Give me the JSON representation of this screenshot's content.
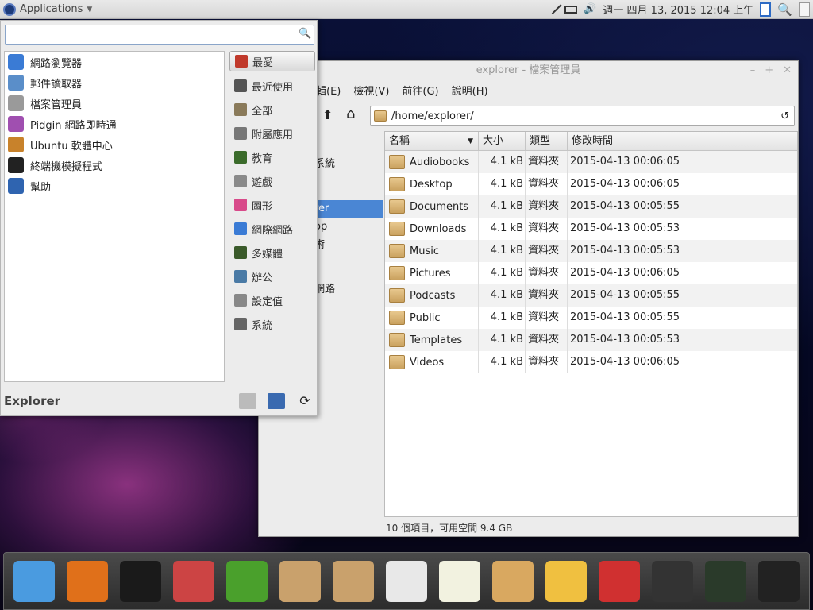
{
  "panel": {
    "applications_label": "Applications",
    "clock": "週一 四月 13, 2015 12:04 上午"
  },
  "menu": {
    "search_placeholder": "",
    "favorites": [
      {
        "label": "網路瀏覽器",
        "icon": "web-browser-icon",
        "color": "#3a7bd5"
      },
      {
        "label": "郵件讀取器",
        "icon": "mail-reader-icon",
        "color": "#5a8ec9"
      },
      {
        "label": "檔案管理員",
        "icon": "file-manager-icon",
        "color": "#9a9a9a"
      },
      {
        "label": "Pidgin 網路即時通",
        "icon": "pidgin-icon",
        "color": "#a04fb0"
      },
      {
        "label": "Ubuntu 軟體中心",
        "icon": "software-center-icon",
        "color": "#c8822b"
      },
      {
        "label": "終端機模擬程式",
        "icon": "terminal-icon",
        "color": "#222222"
      },
      {
        "label": "幫助",
        "icon": "help-icon",
        "color": "#2f64b0"
      }
    ],
    "categories": [
      {
        "label": "最愛",
        "icon": "bookmark-icon",
        "color": "#c0392b"
      },
      {
        "label": "最近使用",
        "icon": "recent-icon",
        "color": "#555555"
      },
      {
        "label": "全部",
        "icon": "all-apps-icon",
        "color": "#8a7a5a"
      },
      {
        "label": "附屬應用",
        "icon": "accessories-icon",
        "color": "#777777"
      },
      {
        "label": "教育",
        "icon": "education-icon",
        "color": "#3b6b2b"
      },
      {
        "label": "遊戲",
        "icon": "games-icon",
        "color": "#8a8a8a"
      },
      {
        "label": "圖形",
        "icon": "graphics-icon",
        "color": "#d84a8a"
      },
      {
        "label": "網際網路",
        "icon": "internet-icon",
        "color": "#3a7bd5"
      },
      {
        "label": "多媒體",
        "icon": "multimedia-icon",
        "color": "#3a5a2a"
      },
      {
        "label": "辦公",
        "icon": "office-icon",
        "color": "#4a7aa5"
      },
      {
        "label": "設定值",
        "icon": "settings-icon",
        "color": "#888888"
      },
      {
        "label": "系統",
        "icon": "system-icon",
        "color": "#666666"
      }
    ],
    "user_name": "Explorer"
  },
  "file_manager": {
    "title": "explorer - 檔案管理員",
    "menubar": [
      "輯(E)",
      "檢視(V)",
      "前往(G)",
      "說明(H)"
    ],
    "path": "/home/explorer/",
    "sidebar_fragments": [
      "系統",
      "rer",
      "op",
      "術",
      "網路"
    ],
    "columns": [
      "名稱",
      "大小",
      "類型",
      "修改時間"
    ],
    "files": [
      {
        "name": "Audiobooks",
        "size": "4.1 kB",
        "type": "資料夾",
        "modified": "2015-04-13 00:06:05",
        "icon": "folder-icon"
      },
      {
        "name": "Desktop",
        "size": "4.1 kB",
        "type": "資料夾",
        "modified": "2015-04-13 00:06:05",
        "icon": "desktop-folder-icon"
      },
      {
        "name": "Documents",
        "size": "4.1 kB",
        "type": "資料夾",
        "modified": "2015-04-13 00:05:55",
        "icon": "documents-folder-icon"
      },
      {
        "name": "Downloads",
        "size": "4.1 kB",
        "type": "資料夾",
        "modified": "2015-04-13 00:05:53",
        "icon": "downloads-folder-icon"
      },
      {
        "name": "Music",
        "size": "4.1 kB",
        "type": "資料夾",
        "modified": "2015-04-13 00:05:53",
        "icon": "music-folder-icon"
      },
      {
        "name": "Pictures",
        "size": "4.1 kB",
        "type": "資料夾",
        "modified": "2015-04-13 00:06:05",
        "icon": "pictures-folder-icon"
      },
      {
        "name": "Podcasts",
        "size": "4.1 kB",
        "type": "資料夾",
        "modified": "2015-04-13 00:05:55",
        "icon": "folder-icon"
      },
      {
        "name": "Public",
        "size": "4.1 kB",
        "type": "資料夾",
        "modified": "2015-04-13 00:05:55",
        "icon": "public-folder-icon"
      },
      {
        "name": "Templates",
        "size": "4.1 kB",
        "type": "資料夾",
        "modified": "2015-04-13 00:05:53",
        "icon": "templates-folder-icon"
      },
      {
        "name": "Videos",
        "size": "4.1 kB",
        "type": "資料夾",
        "modified": "2015-04-13 00:06:05",
        "icon": "videos-folder-icon"
      }
    ],
    "status": "10 個項目，可用空間 9.4 GB"
  },
  "dock": [
    {
      "icon": "anchor-icon",
      "color": "#4a9be0"
    },
    {
      "icon": "firefox-icon",
      "color": "#e0701a"
    },
    {
      "icon": "terminal-icon",
      "color": "#1a1a1a"
    },
    {
      "icon": "network-tool-icon",
      "color": "#c44"
    },
    {
      "icon": "keys-icon",
      "color": "#4aa02c"
    },
    {
      "icon": "package-installer-icon",
      "color": "#c9a16c"
    },
    {
      "icon": "package-download-icon",
      "color": "#c9a16c"
    },
    {
      "icon": "blank-document-icon",
      "color": "#e8e8e8"
    },
    {
      "icon": "text-editor-icon",
      "color": "#f2f2e0"
    },
    {
      "icon": "paint-palette-icon",
      "color": "#d9a860"
    },
    {
      "icon": "bluetooth-app-icon",
      "color": "#f0c040"
    },
    {
      "icon": "disc-burner-icon",
      "color": "#d03030"
    },
    {
      "icon": "vlc-icon",
      "color": "#333"
    },
    {
      "icon": "camera-icon",
      "color": "#2a3a2a"
    },
    {
      "icon": "system-monitor-icon",
      "color": "#222"
    }
  ]
}
